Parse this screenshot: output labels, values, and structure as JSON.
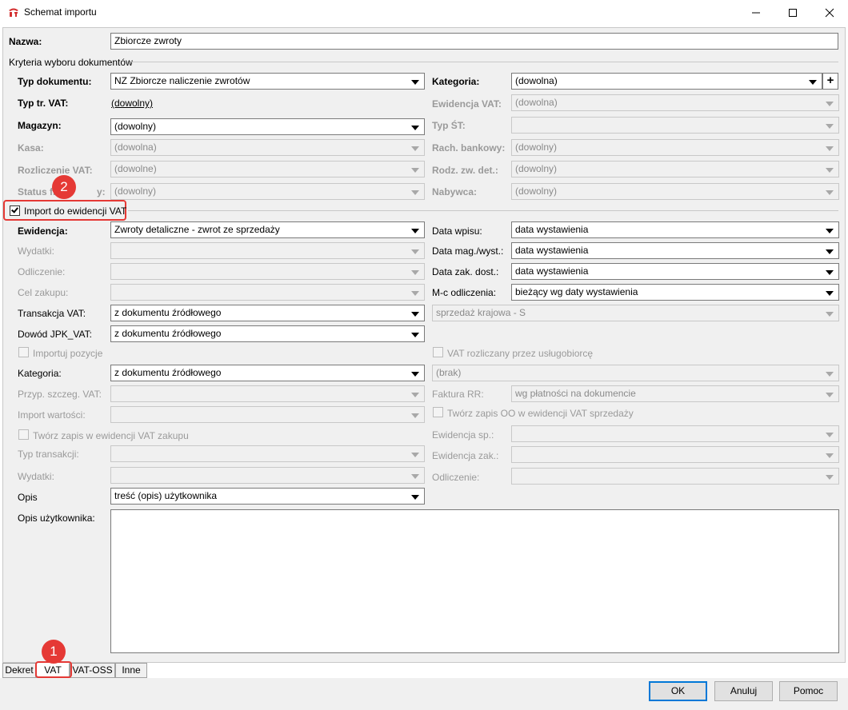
{
  "window": {
    "title": "Schemat importu",
    "buttons": {
      "minimize": "—",
      "maximize": "☐",
      "close": "✕"
    }
  },
  "nazwa": {
    "label": "Nazwa:",
    "value": "Zbiorcze zwroty"
  },
  "criteria": {
    "section_label": "Kryteria wyboru dokumentów",
    "typ_dokumentu": {
      "label": "Typ dokumentu:",
      "value": "NZ Zbiorcze naliczenie zwrotów"
    },
    "kategoria": {
      "label": "Kategoria:",
      "value": "(dowolna)",
      "add": "+"
    },
    "typ_tr_vat": {
      "label": "Typ tr. VAT:",
      "value": "(dowolny)"
    },
    "ewidencja_vat": {
      "label": "Ewidencja VAT:",
      "value": "(dowolna)"
    },
    "magazyn": {
      "label": "Magazyn:",
      "value": "(dowolny)"
    },
    "typ_st": {
      "label": "Typ ŚT:",
      "value": ""
    },
    "kasa": {
      "label": "Kasa:",
      "value": "(dowolna)"
    },
    "rach_bankowy": {
      "label": "Rach. bankowy:",
      "value": "(dowolny)"
    },
    "rozliczenie_vat": {
      "label": "Rozliczenie VAT:",
      "value": "(dowolne)"
    },
    "rodz_zw_det": {
      "label": "Rodz. zw. det.:",
      "value": "(dowolny)"
    },
    "status_fiskalny": {
      "label": "Status fi",
      "label_tail": "y:",
      "value": "(dowolny)"
    },
    "nabywca": {
      "label": "Nabywca:",
      "value": "(dowolny)"
    }
  },
  "import_vat": {
    "label": "Import do ewidencji VAT",
    "checked": true
  },
  "vat": {
    "ewidencja": {
      "label": "Ewidencja:",
      "value": "Zwroty detaliczne - zwrot ze sprzedaży"
    },
    "data_wpisu": {
      "label": "Data wpisu:",
      "value": "data wystawienia"
    },
    "wydatki": {
      "label": "Wydatki:",
      "value": ""
    },
    "data_mag": {
      "label": "Data mag./wyst.:",
      "value": "data wystawienia"
    },
    "odliczenie": {
      "label": "Odliczenie:",
      "value": ""
    },
    "data_zak": {
      "label": "Data zak. dost.:",
      "value": "data wystawienia"
    },
    "cel_zakupu": {
      "label": "Cel zakupu:",
      "value": ""
    },
    "mc_odliczenia": {
      "label": "M-c odliczenia:",
      "value": "bieżący wg daty wystawienia"
    },
    "transakcja_vat": {
      "label": "Transakcja VAT:",
      "value": "z dokumentu źródłowego"
    },
    "sprzedaz": {
      "value": "sprzedaż krajowa - S"
    },
    "dowod_jpk": {
      "label": "Dowód JPK_VAT:",
      "value": "z dokumentu źródłowego"
    },
    "importuj_pozycje": {
      "label": "Importuj pozycje"
    },
    "vat_uslugobiorca": {
      "label": "VAT rozliczany przez usługobiorcę"
    },
    "kategoria": {
      "label": "Kategoria:",
      "value": "z dokumentu źródłowego"
    },
    "brak": {
      "value": "(brak)"
    },
    "przyp_szczeg": {
      "label": "Przyp. szczeg. VAT:",
      "value": ""
    },
    "faktura_rr": {
      "label": "Faktura RR:",
      "value": "wg płatności na dokumencie"
    },
    "import_wartosci": {
      "label": "Import wartości:",
      "value": ""
    },
    "tworz_oo": {
      "label": "Twórz zapis OO w ewidencji VAT sprzedaży"
    },
    "tworz_zakupu": {
      "label": "Twórz zapis w ewidencji VAT zakupu"
    },
    "ewidencja_sp": {
      "label": "Ewidencja sp.:",
      "value": ""
    },
    "typ_transakcji": {
      "label": "Typ transakcji:",
      "value": ""
    },
    "ewidencja_zak": {
      "label": "Ewidencja zak.:",
      "value": ""
    },
    "wydatki2": {
      "label": "Wydatki:",
      "value": ""
    },
    "odliczenie2": {
      "label": "Odliczenie:",
      "value": ""
    },
    "opis": {
      "label": "Opis",
      "value": "treść (opis) użytkownika"
    },
    "opis_uzytkownika": {
      "label": "Opis użytkownika:",
      "value": ""
    }
  },
  "annotations": {
    "badge1": "1",
    "badge2": "2"
  },
  "tabs": [
    "Dekret",
    "VAT",
    "VAT-OSS",
    "Inne"
  ],
  "buttons": {
    "ok": "OK",
    "anuluj": "Anuluj",
    "pomoc": "Pomoc"
  },
  "colors": {
    "highlight": "#e53935",
    "focus": "#0078d7",
    "panel": "#f0f0f0"
  }
}
